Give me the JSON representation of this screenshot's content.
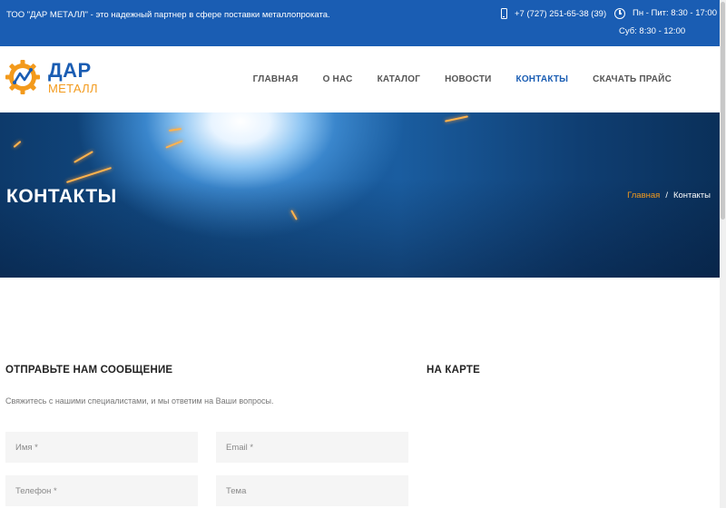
{
  "topbar": {
    "tagline": "ТОО \"ДАР МЕТАЛЛ\" - это надежный партнер в сфере поставки металлопроката.",
    "phone": "+7 (727) 251-65-38 (39)",
    "hours_weekdays": "Пн - Пит: 8:30 - 17:00",
    "hours_saturday": "Суб: 8:30 - 12:00",
    "phone_icon": "phone-icon",
    "clock_icon": "clock-icon"
  },
  "logo": {
    "name_top": "ДАР",
    "name_bottom": "МЕТАЛЛ",
    "icon": "gear-logo-icon"
  },
  "nav": {
    "items": [
      "ГЛАВНАЯ",
      "О НАС",
      "КАТАЛОГ",
      "НОВОСТИ",
      "КОНТАКТЫ",
      "СКАЧАТЬ ПРАЙС"
    ],
    "active_item": "КОНТАКТЫ"
  },
  "hero": {
    "title": "КОНТАКТЫ",
    "breadcrumb": {
      "home": "Главная",
      "separator": "/",
      "current": "Контакты"
    }
  },
  "form": {
    "title": "ОТПРАВЬТЕ НАМ СООБЩЕНИЕ",
    "description": "Свяжитесь с нашими специалистами, и мы ответим на Ваши вопросы.",
    "name_placeholder": "Имя *",
    "email_placeholder": "Email *",
    "phone_placeholder": "Телефон *",
    "topic_placeholder": "Тема"
  },
  "map": {
    "title": "НА КАРТЕ"
  },
  "colors": {
    "brand_blue": "#1a5db3",
    "accent_orange": "#f39a1c"
  }
}
